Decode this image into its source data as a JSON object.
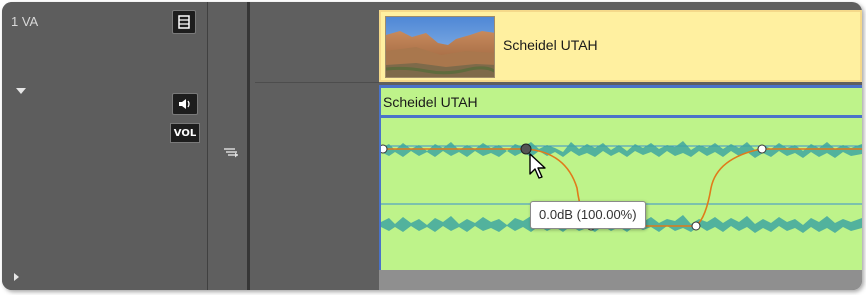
{
  "track": {
    "name": "1 VA"
  },
  "header": {
    "view_icon": "panel-view-icon",
    "mute_icon": "speaker-icon",
    "volume_label": "VOL",
    "sync_icon": "sync-lock-icon"
  },
  "clip": {
    "video_title": "Scheidel UTAH",
    "audio_title": "Scheidel UTAH",
    "thumbnail_icon": "canyon-thumbnail"
  },
  "tooltip": {
    "text": "0.0dB (100.00%)"
  },
  "colors": {
    "video_clip_bg": "#fff0a0",
    "audio_clip_bg": "#bef38a",
    "selection_border": "#4a72c9",
    "rubberband": "#e07a1a",
    "waveform": "#3fa6a0"
  }
}
